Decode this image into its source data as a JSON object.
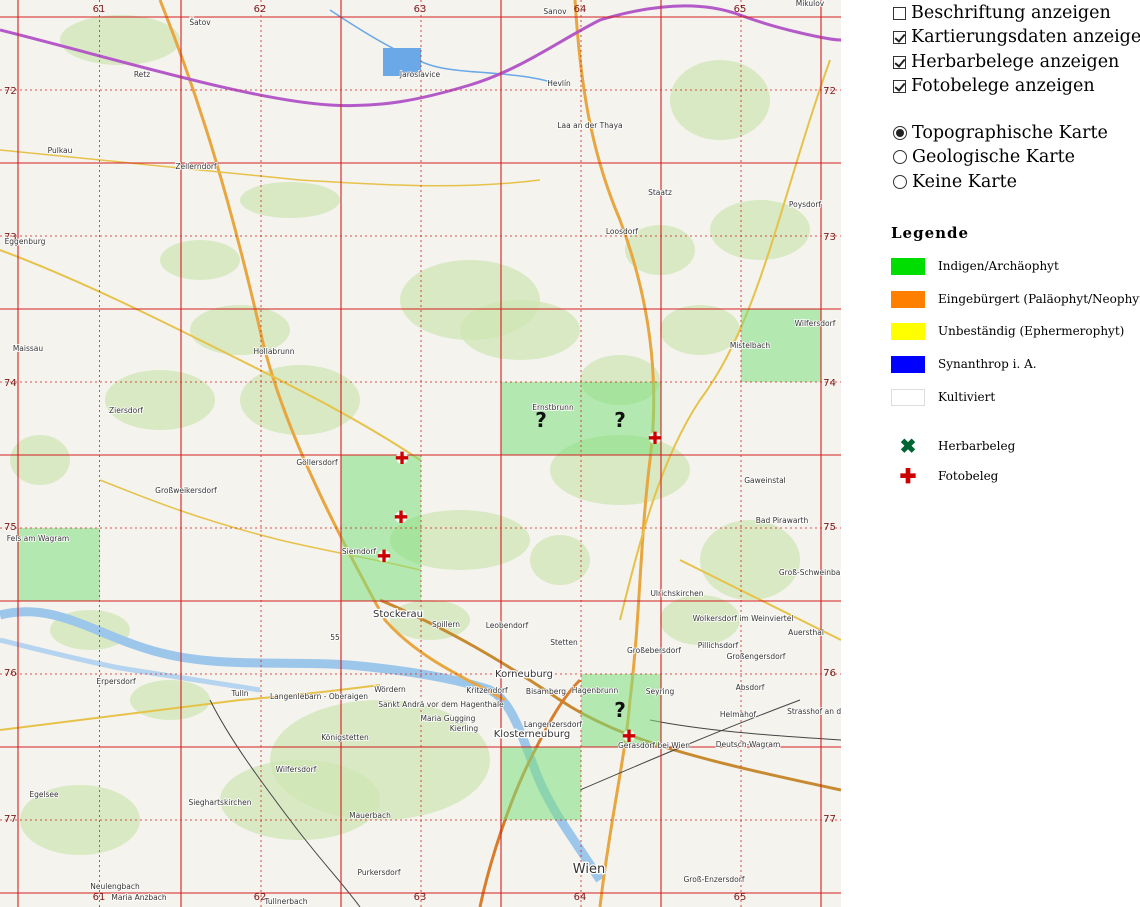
{
  "options": {
    "checkboxes": [
      {
        "label": "Beschriftung anzeigen",
        "checked": false
      },
      {
        "label": "Kartierungsdaten anzeigen",
        "checked": true
      },
      {
        "label": "Herbarbelege anzeigen",
        "checked": true
      },
      {
        "label": "Fotobelege anzeigen",
        "checked": true
      }
    ],
    "radios": [
      {
        "label": "Topographische Karte",
        "selected": true
      },
      {
        "label": "Geologische Karte",
        "selected": false
      },
      {
        "label": "Keine Karte",
        "selected": false
      }
    ]
  },
  "legend": {
    "title": "Legende",
    "items": [
      {
        "label": "Indigen/Archäophyt",
        "color": "#00dd00"
      },
      {
        "label": "Eingebürgert (Paläophyt/Neophyt)",
        "color": "#ff7f00"
      },
      {
        "label": "Unbeständig (Ephermerophyt)",
        "color": "#ffff00"
      },
      {
        "label": "Synanthrop i. A.",
        "color": "#0000ff"
      },
      {
        "label": "Kultiviert",
        "color": "#ffffff"
      }
    ],
    "symbols": [
      {
        "label": "Herbarbeleg",
        "glyph": "✖",
        "color": "#006633"
      },
      {
        "label": "Fotobeleg",
        "glyph": "✚",
        "color": "#cc0000"
      }
    ]
  },
  "map": {
    "grid_cols": [
      "61",
      "62",
      "63",
      "64",
      "65"
    ],
    "grid_rows": [
      "72",
      "73",
      "74",
      "75",
      "76",
      "77"
    ],
    "places": [
      {
        "name": "Šatov"
      },
      {
        "name": "Sanov"
      },
      {
        "name": "Mikulov"
      },
      {
        "name": "Retz"
      },
      {
        "name": "Jaroslavice"
      },
      {
        "name": "Hevlín"
      },
      {
        "name": "Pulkau"
      },
      {
        "name": "Laa an der Thaya"
      },
      {
        "name": "Zellerndorf"
      },
      {
        "name": "Staatz"
      },
      {
        "name": "Poysdorf"
      },
      {
        "name": "Eggenburg"
      },
      {
        "name": "Loosdorf"
      },
      {
        "name": "Wilfersdorf"
      },
      {
        "name": "Maissau"
      },
      {
        "name": "Hollabrunn"
      },
      {
        "name": "Mistelbach"
      },
      {
        "name": "Ziersdorf"
      },
      {
        "name": "Ernstbrunn"
      },
      {
        "name": "Göllersdorf"
      },
      {
        "name": "Großweikersdorf"
      },
      {
        "name": "Gaweinstal"
      },
      {
        "name": "Bad Pirawarth"
      },
      {
        "name": "Fels am Wagram"
      },
      {
        "name": "Sierndorf"
      },
      {
        "name": "Groß-Schweinbarth"
      },
      {
        "name": "Ulrichskirchen"
      },
      {
        "name": "Stockerau"
      },
      {
        "name": "Spillern"
      },
      {
        "name": "Leobendorf"
      },
      {
        "name": "Wolkersdorf im Weinviertel"
      },
      {
        "name": "Stetten"
      },
      {
        "name": "Pillichsdorf"
      },
      {
        "name": "Auersthal"
      },
      {
        "name": "Großebersdorf"
      },
      {
        "name": "Großengersdorf"
      },
      {
        "name": "Korneuburg"
      },
      {
        "name": "Bisamberg"
      },
      {
        "name": "Hagenbrunn"
      },
      {
        "name": "Seyring"
      },
      {
        "name": "Absdorf"
      },
      {
        "name": "Tulln"
      },
      {
        "name": "Langenlebarn - Oberaigen"
      },
      {
        "name": "Kritzendorf"
      },
      {
        "name": "Helmahof"
      },
      {
        "name": "Strasshof an der"
      },
      {
        "name": "Wördern"
      },
      {
        "name": "Sankt Andrä vor dem Hagenthale"
      },
      {
        "name": "Langenzersdorf"
      },
      {
        "name": "Maria Gugging"
      },
      {
        "name": "Kierling"
      },
      {
        "name": "Klosterneuburg"
      },
      {
        "name": "Gerasdorf bei Wien"
      },
      {
        "name": "Deutsch-Wagram"
      },
      {
        "name": "Königstetten"
      },
      {
        "name": "Wilfersdorf"
      },
      {
        "name": "Egelsee"
      },
      {
        "name": "Sieghartskirchen"
      },
      {
        "name": "Mauerbach"
      },
      {
        "name": "Purkersdorf"
      },
      {
        "name": "Wien"
      },
      {
        "name": "Groß-Enzersdorf"
      },
      {
        "name": "Neulengbach"
      },
      {
        "name": "Maria Anzbach"
      },
      {
        "name": "Tullnerbach"
      },
      {
        "name": "Erpersdorf"
      },
      {
        "name": "55"
      }
    ],
    "markers": [
      {
        "type": "foto",
        "glyph": "✚"
      },
      {
        "type": "foto",
        "glyph": "✚"
      },
      {
        "type": "foto",
        "glyph": "✚"
      },
      {
        "type": "foto",
        "glyph": "✚"
      },
      {
        "type": "foto",
        "glyph": "✚"
      },
      {
        "type": "unknown",
        "glyph": "?"
      },
      {
        "type": "unknown",
        "glyph": "?"
      },
      {
        "type": "unknown",
        "glyph": "?"
      }
    ]
  }
}
